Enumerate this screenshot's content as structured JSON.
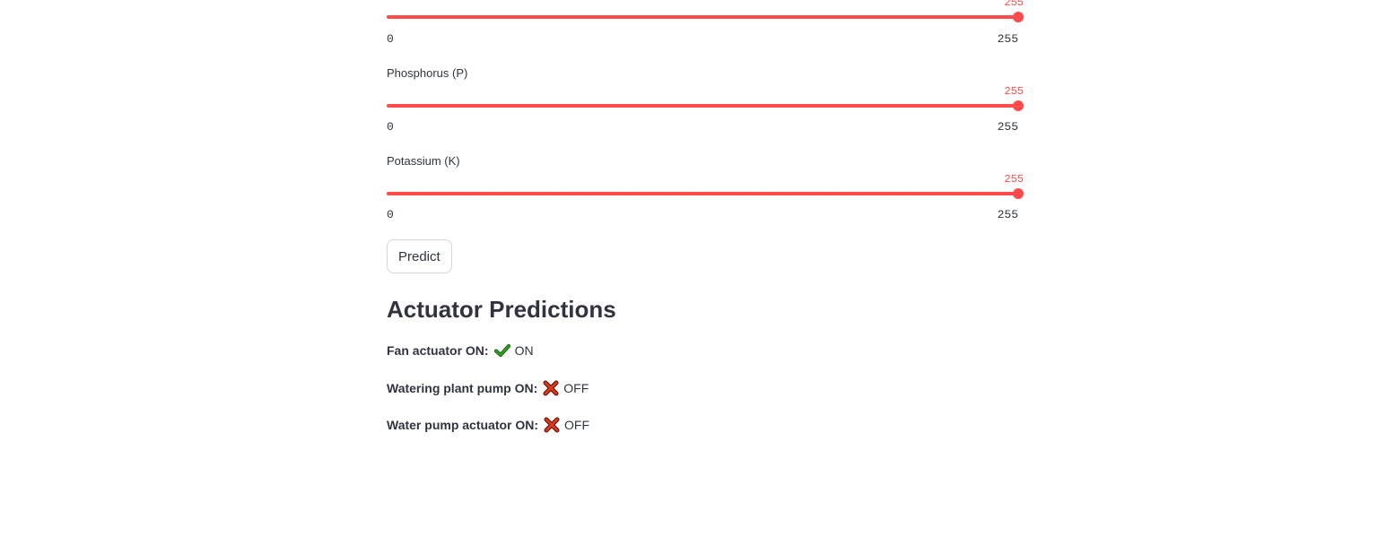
{
  "sliders": [
    {
      "label": "",
      "value": "255",
      "min": "0",
      "max": "255",
      "fraction": 1.0
    },
    {
      "label": "Phosphorus (P)",
      "value": "255",
      "min": "0",
      "max": "255",
      "fraction": 1.0
    },
    {
      "label": "Potassium (K)",
      "value": "255",
      "min": "0",
      "max": "255",
      "fraction": 1.0
    }
  ],
  "predict_button": {
    "label": "Predict"
  },
  "predictions": {
    "title": "Actuator Predictions",
    "items": [
      {
        "label": "Fan actuator ON:",
        "icon": "check-icon",
        "status": "ON"
      },
      {
        "label": "Watering plant pump ON:",
        "icon": "cross-icon",
        "status": "OFF"
      },
      {
        "label": "Water pump actuator ON:",
        "icon": "cross-icon",
        "status": "OFF"
      }
    ]
  },
  "colors": {
    "accent": "#ff4b4b",
    "text": "#31333f",
    "check": "#2e9e1f",
    "cross": "#d93a1e"
  }
}
